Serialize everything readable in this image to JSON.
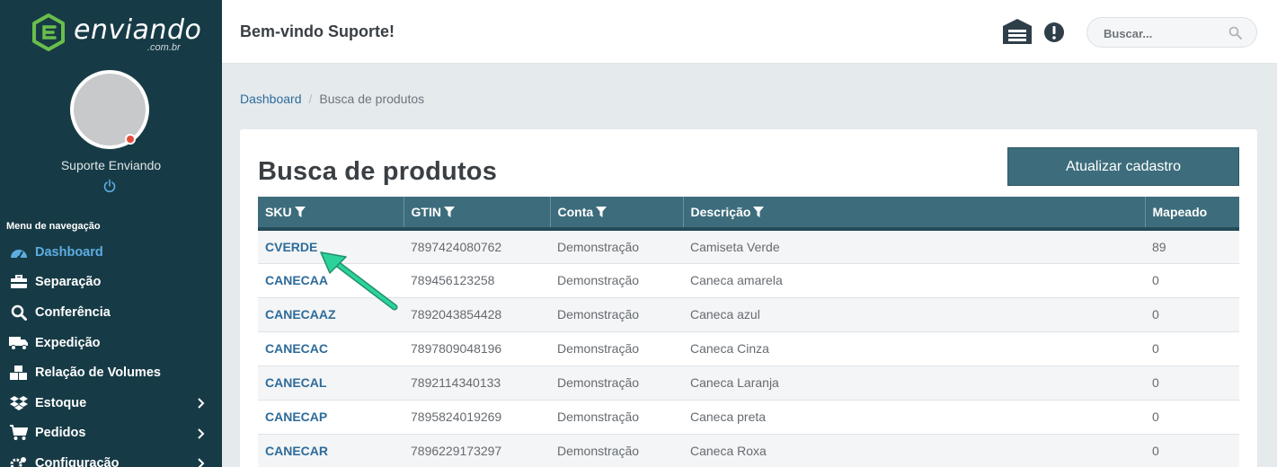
{
  "brand": {
    "name": "enviando",
    "domain": ".com.br",
    "color": "#4caf50"
  },
  "user": {
    "name": "Suporte Enviando"
  },
  "nav": {
    "title": "Menu de navegação",
    "items": [
      {
        "label": "Dashboard",
        "icon": "dashboard-icon",
        "active": true
      },
      {
        "label": "Separação",
        "icon": "toolbox-icon"
      },
      {
        "label": "Conferência",
        "icon": "search-icon"
      },
      {
        "label": "Expedição",
        "icon": "truck-icon"
      },
      {
        "label": "Relação de Volumes",
        "icon": "boxes-icon"
      },
      {
        "label": "Estoque",
        "icon": "dropbox-icon",
        "expandable": true
      },
      {
        "label": "Pedidos",
        "icon": "cart-icon",
        "expandable": true
      },
      {
        "label": "Configuração",
        "icon": "gears-icon",
        "expandable": true
      }
    ]
  },
  "header": {
    "welcome": "Bem-vindo Suporte!",
    "search_placeholder": "Buscar..."
  },
  "breadcrumb": {
    "home": "Dashboard",
    "current": "Busca de produtos"
  },
  "page": {
    "title": "Busca de produtos",
    "update_button": "Atualizar cadastro"
  },
  "table": {
    "columns": [
      "SKU",
      "GTIN",
      "Conta",
      "Descrição",
      "Mapeado"
    ],
    "rows": [
      {
        "sku": "CVERDE",
        "gtin": "7897424080762",
        "conta": "Demonstração",
        "descricao": "Camiseta Verde",
        "mapeado": "89"
      },
      {
        "sku": "CANECAA",
        "gtin": "789456123258",
        "conta": "Demonstração",
        "descricao": "Caneca amarela",
        "mapeado": "0"
      },
      {
        "sku": "CANECAAZ",
        "gtin": "7892043854428",
        "conta": "Demonstração",
        "descricao": "Caneca azul",
        "mapeado": "0"
      },
      {
        "sku": "CANECAC",
        "gtin": "7897809048196",
        "conta": "Demonstração",
        "descricao": "Caneca Cinza",
        "mapeado": "0"
      },
      {
        "sku": "CANECAL",
        "gtin": "7892114340133",
        "conta": "Demonstração",
        "descricao": "Caneca Laranja",
        "mapeado": "0"
      },
      {
        "sku": "CANECAP",
        "gtin": "7895824019269",
        "conta": "Demonstração",
        "descricao": "Caneca preta",
        "mapeado": "0"
      },
      {
        "sku": "CANECAR",
        "gtin": "7896229173297",
        "conta": "Demonstração",
        "descricao": "Caneca Roxa",
        "mapeado": "0"
      }
    ]
  },
  "colors": {
    "sidebar": "#173b46",
    "accent": "#3d6d7c",
    "link": "#2e6b9a",
    "arrow": "#2bb58a"
  }
}
